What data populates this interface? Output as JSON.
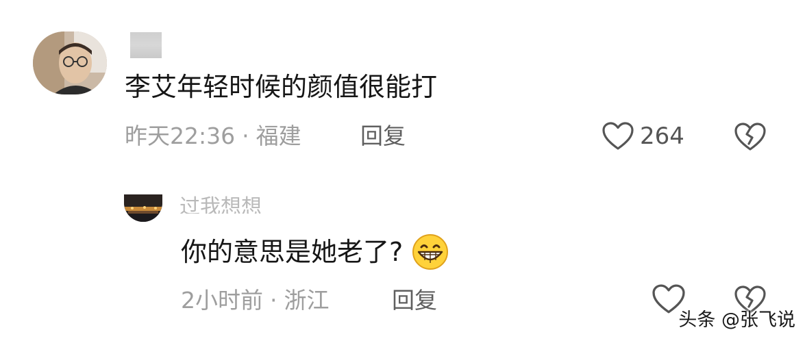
{
  "main_comment": {
    "text": "李艾年轻时候的颜值很能打",
    "time": "昨天22:36",
    "separator": "·",
    "location": "福建",
    "reply_label": "回复",
    "like_count": "264",
    "icons": {
      "like": "heart-outline-icon",
      "dislike": "broken-heart-icon"
    }
  },
  "reply_comment": {
    "username": "过我想想",
    "text": "你的意思是她老了?",
    "emoji": "grinning-face-emoji",
    "time": "2小时前",
    "separator": "·",
    "location": "浙江",
    "reply_label": "回复",
    "icons": {
      "like": "heart-outline-icon",
      "dislike": "broken-heart-icon"
    }
  },
  "watermark": "头条 @张飞说",
  "colors": {
    "text_primary": "#161616",
    "text_meta": "#9e9e9e",
    "text_reply": "#5f5f5f",
    "icon": "#555555",
    "emoji_fill": "#ffd23a"
  }
}
